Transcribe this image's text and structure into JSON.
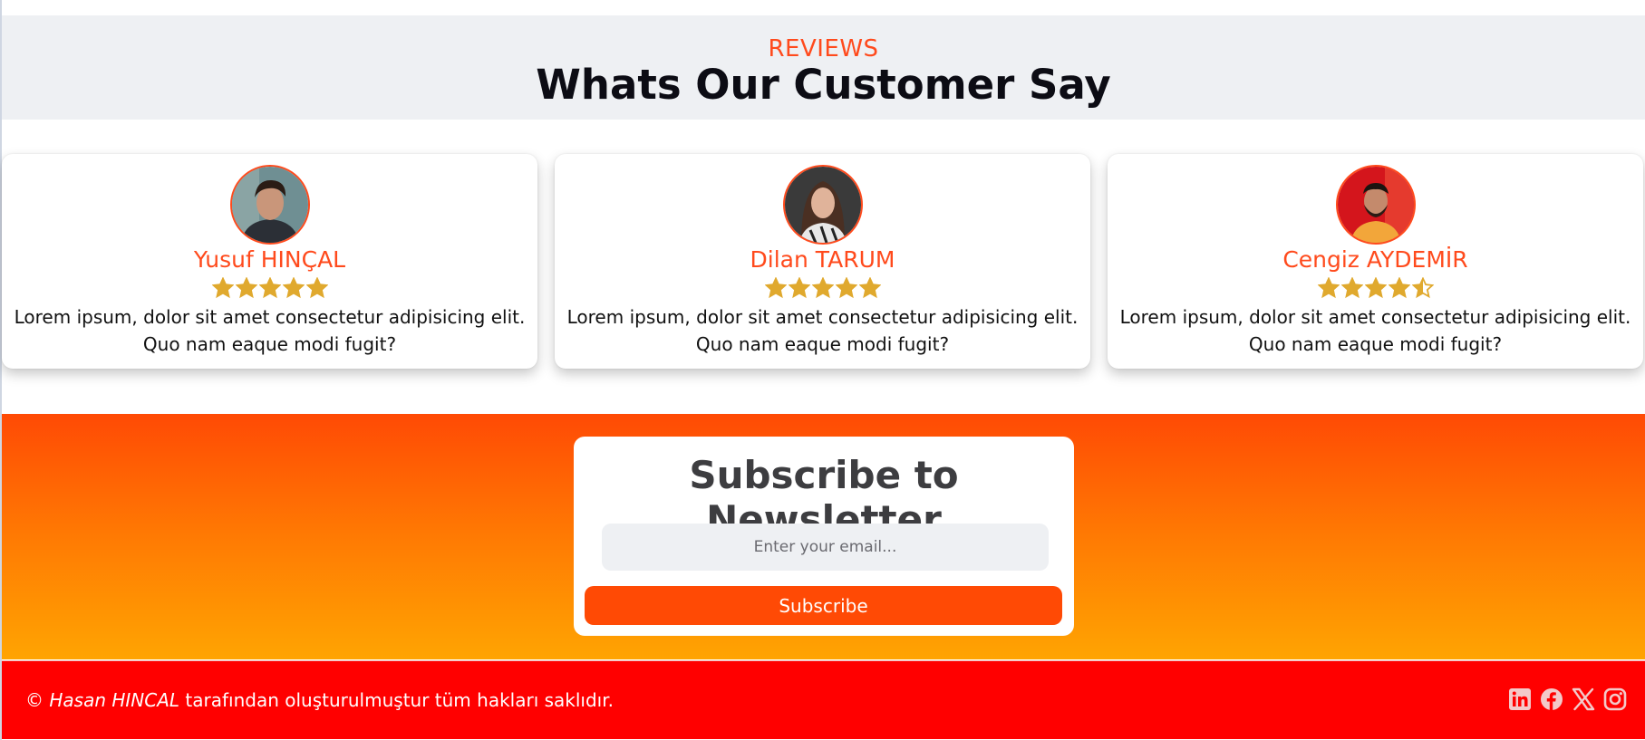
{
  "header": {
    "eyebrow": "REVIEWS",
    "title": "Whats Our Customer Say"
  },
  "reviews": [
    {
      "name": "Yusuf HINÇAL",
      "rating": 5,
      "text": "Lorem ipsum, dolor sit amet consectetur adipisicing elit. Quo nam eaque modi fugit?",
      "avatar_icon": "avatar-photo-young-man"
    },
    {
      "name": "Dilan TARUM",
      "rating": 5,
      "text": "Lorem ipsum, dolor sit amet consectetur adipisicing elit. Quo nam eaque modi fugit?",
      "avatar_icon": "avatar-photo-woman"
    },
    {
      "name": "Cengiz AYDEMİR",
      "rating": 4.5,
      "text": "Lorem ipsum, dolor sit amet consectetur adipisicing elit. Quo nam eaque modi fugit?",
      "avatar_icon": "avatar-photo-bearded-man"
    }
  ],
  "newsletter": {
    "title": "Subscribe to Newsletter",
    "email_placeholder": "Enter your email...",
    "email_value": "",
    "button_label": "Subscribe"
  },
  "footer": {
    "copyright_symbol": "©",
    "author": "Hasan HINCAL",
    "copyright_rest": "tarafından oluşturulmuştur tüm hakları saklıdır.",
    "social_icons": [
      "linkedin-icon",
      "facebook-icon",
      "x-icon",
      "instagram-icon"
    ]
  },
  "colors": {
    "accent": "#ff4a1c",
    "star": "#e0a92e",
    "header_bg": "#eef0f3",
    "footer_bg": "#ff0000",
    "gradient_top": "#ff4a05",
    "gradient_bottom": "#ffa402"
  }
}
